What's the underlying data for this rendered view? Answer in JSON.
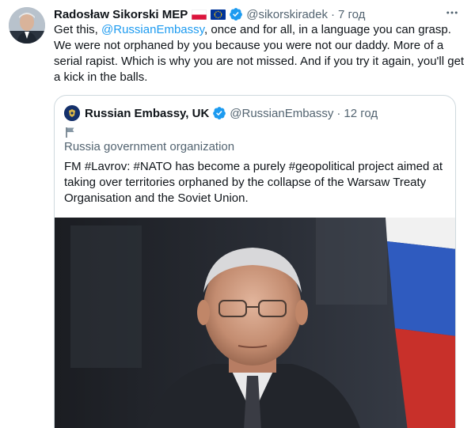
{
  "tweet": {
    "author_name": "Radosław Sikorski MEP",
    "flag_1": "poland-flag-icon",
    "flag_2": "eu-flag-icon",
    "verified": "verified-badge-icon",
    "handle": "@sikorskiradek",
    "separator": "·",
    "time": "7 год",
    "text_part1": "Get this, ",
    "mention": "@RussianEmbassy",
    "text_part2": ", once and for all, in a language you can grasp. We were not orphaned by you because you were not our daddy. More of a serial rapist. Which is why you are not missed. And if you try it again, you'll get a kick in the balls."
  },
  "quoted_tweet": {
    "author_name": "Russian Embassy, UK",
    "handle": "@RussianEmbassy",
    "separator": "·",
    "time": "12 год",
    "org_label": "Russia government organization",
    "text": "FM #Lavrov: #NATO has become a purely #geopolitical project aimed at taking over territories orphaned by the collapse of the Warsaw Treaty Organisation and the Soviet Union."
  },
  "colors": {
    "accent": "#1d9bf0",
    "text": "#0f1419",
    "secondary": "#536471",
    "border": "#cfd9de"
  }
}
